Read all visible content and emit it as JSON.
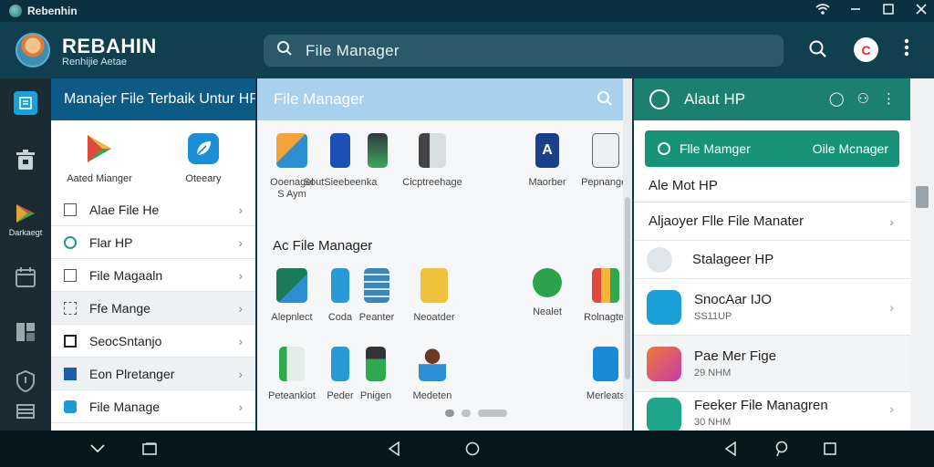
{
  "window": {
    "title": "Rebenhin"
  },
  "header": {
    "brand": "REBAHIN",
    "brand_sub": "Renhijie Aetae",
    "search_text": "File  Manager",
    "chrome_letter": "C"
  },
  "rail": {
    "items": [
      {
        "icon": "app-window-icon",
        "color": "#1aa0d8"
      },
      {
        "icon": "trash-icon",
        "color": "#c7d2d6"
      },
      {
        "icon": "play-store-icon",
        "color": "#e0a23b",
        "label": "Darkaegt"
      },
      {
        "icon": "calendar-icon",
        "color": "#9aa9ae"
      },
      {
        "icon": "grid-icon",
        "color": "#9aa9ae"
      },
      {
        "icon": "shield-icon",
        "color": "#9aa9ae"
      }
    ]
  },
  "panel1": {
    "title": "Manajer File Terbaik Untur HP",
    "apps": [
      {
        "label": "Aated Mianger",
        "icon": "kite-icon"
      },
      {
        "label": "Oteeary",
        "icon": "leaf-icon"
      }
    ],
    "items": [
      {
        "label": "Alae File He"
      },
      {
        "label": "Flar HP"
      },
      {
        "label": "File Magaaln"
      },
      {
        "label": "Ffe Mange"
      },
      {
        "label": "SeocSntanjo"
      },
      {
        "label": "Eon Plretanger"
      },
      {
        "label": "File Manage"
      }
    ]
  },
  "panel2": {
    "title": "File Manager",
    "section_title": "Ac File Manager",
    "row1": [
      {
        "label": "Ooenagel\nS Aym",
        "icon": "folder-clock-icon"
      },
      {
        "label": "SoutSieebeenka",
        "icon": "phone-icon"
      },
      {
        "label": "",
        "icon": "phone-green-icon"
      },
      {
        "label": "Cicptreehage",
        "icon": "phone-stack-icon"
      },
      {
        "label": "Maorber",
        "icon": "letter-a-icon"
      },
      {
        "label": "Pepnanger",
        "icon": "calculator-icon"
      }
    ],
    "row2": [
      {
        "label": "Alepnlect",
        "icon": "globe-folder-icon"
      },
      {
        "label": "Coda",
        "icon": "money-doc-icon"
      },
      {
        "label": "Peanter",
        "icon": "database-icon"
      },
      {
        "label": "Neoatder",
        "icon": "yellow-doc-icon"
      },
      {
        "label": "Nealet",
        "icon": "refresh-green-icon"
      },
      {
        "label": "Rolnagter",
        "icon": "stripe-icon"
      }
    ],
    "row3": [
      {
        "label": "Peteankiot",
        "icon": "green-doc-icon"
      },
      {
        "label": "Peder",
        "icon": "money-doc-icon"
      },
      {
        "label": "Pnigen",
        "icon": "calculator-phone-icon"
      },
      {
        "label": "Medeten",
        "icon": "person-reading-icon"
      },
      {
        "label": "Merleats",
        "icon": "blue-money-icon"
      }
    ]
  },
  "panel3": {
    "title": "Alaut HP",
    "cta_left": "Flle Mamger",
    "cta_right": "Oile Mcnager",
    "items": [
      {
        "title": "Ale Mot HP",
        "subtitle": ""
      },
      {
        "title": "Aljaoyer Flle File Manater",
        "subtitle": ""
      },
      {
        "title": "Stalageer HP",
        "subtitle": ""
      },
      {
        "title": "SnocAar IJO",
        "subtitle": "SS11UP"
      },
      {
        "title": "Pae Mer Fige",
        "subtitle": "29 NHM"
      },
      {
        "title": "Feeker File Managren",
        "subtitle": "30 NHM"
      }
    ]
  }
}
